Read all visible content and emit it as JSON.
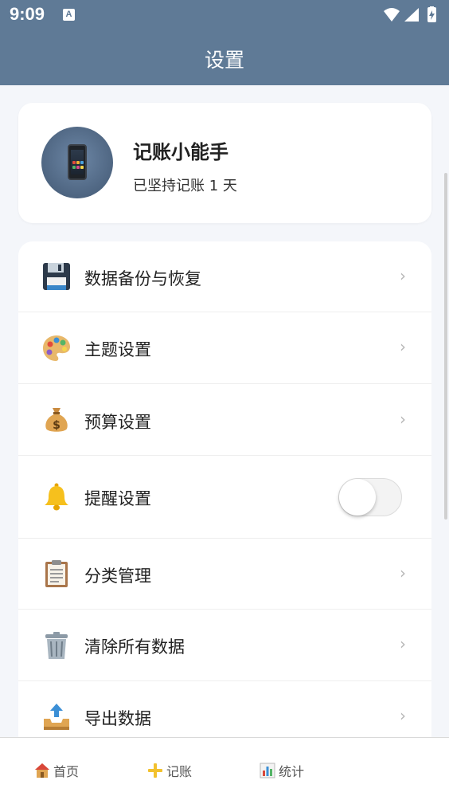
{
  "status_bar": {
    "time": "9:09",
    "notification_icon": "A"
  },
  "app_bar": {
    "title": "设置"
  },
  "profile": {
    "name": "记账小能手",
    "subtitle": "已坚持记账 1 天",
    "avatar_icon": "phone-icon"
  },
  "menu": {
    "items": [
      {
        "label": "数据备份与恢复",
        "icon": "floppy-disk-icon",
        "chevron": "›"
      },
      {
        "label": "主题设置",
        "icon": "palette-icon",
        "chevron": "›"
      },
      {
        "label": "预算设置",
        "icon": "money-bag-icon",
        "chevron": "›"
      },
      {
        "label": "提醒设置",
        "icon": "bell-icon",
        "toggle_on": false
      },
      {
        "label": "分类管理",
        "icon": "clipboard-icon",
        "chevron": "›"
      },
      {
        "label": "清除所有数据",
        "icon": "trash-can-icon",
        "chevron": "›"
      },
      {
        "label": "导出数据",
        "icon": "outbox-tray-icon",
        "chevron": "›"
      }
    ]
  },
  "bottom_nav": {
    "items": [
      {
        "label": "首页",
        "icon": "house-icon"
      },
      {
        "label": "记账",
        "icon": "plus-icon"
      },
      {
        "label": "统计",
        "icon": "bar-chart-icon"
      }
    ]
  },
  "colors": {
    "header": "#5f7a96",
    "background": "#f4f6fa",
    "card": "#ffffff"
  }
}
